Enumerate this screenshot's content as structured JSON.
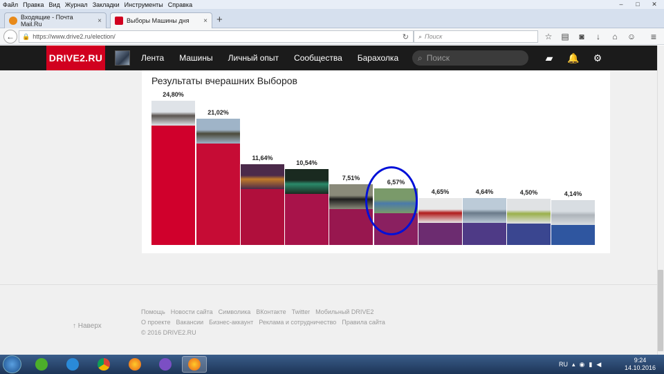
{
  "menu": [
    "Файл",
    "Правка",
    "Вид",
    "Журнал",
    "Закладки",
    "Инструменты",
    "Справка"
  ],
  "window_controls": [
    "–",
    "□",
    "✕"
  ],
  "tabs": [
    {
      "label": "Входящие - Почта Mail.Ru",
      "favicon_color": "#e88a1a"
    },
    {
      "label": "Выборы Машины дня",
      "favicon_color": "#d1001f"
    }
  ],
  "tab_close": "×",
  "new_tab": "+",
  "address": {
    "url": "https://www.drive2.ru/election/",
    "search_placeholder": "Поиск"
  },
  "site": {
    "logo": "DRIVE2.RU",
    "nav": [
      "Лента",
      "Машины",
      "Личный опыт",
      "Сообщества",
      "Барахолка"
    ],
    "search_placeholder": "Поиск"
  },
  "section_title": "Результаты вчерашних Выборов",
  "chart_data": {
    "type": "bar",
    "title": "Результаты вчерашних Выборов",
    "values": [
      24.8,
      21.02,
      11.64,
      10.54,
      7.51,
      6.57,
      4.65,
      4.64,
      4.5,
      4.14
    ],
    "labels": [
      "24,80%",
      "21,02%",
      "11,64%",
      "10,54%",
      "7,51%",
      "6,57%",
      "4,65%",
      "4,64%",
      "4,50%",
      "4,14%"
    ],
    "colors": [
      "#d0002c",
      "#c60c35",
      "#b00f3c",
      "#a8134a",
      "#98174f",
      "#8a2060",
      "#6c2c70",
      "#4e3a86",
      "#3a4690",
      "#2f56a0"
    ],
    "photo_colors": [
      [
        "#dfe3e8",
        "#5b5450"
      ],
      [
        "#9fb4c8",
        "#4b4a3a"
      ],
      [
        "#4b2a4a",
        "#c07a2a"
      ],
      [
        "#1a2a20",
        "#2a8a6a"
      ],
      [
        "#8a8a7a",
        "#1e1e1e"
      ],
      [
        "#7a9a6a",
        "#4a7aaa"
      ],
      [
        "#e8e8e8",
        "#b01a1a"
      ],
      [
        "#bccbd8",
        "#6a7a8a"
      ],
      [
        "#e0e2e4",
        "#9ab04a"
      ],
      [
        "#d8dde2",
        "#aeb4ba"
      ]
    ],
    "highlighted_index": 5
  },
  "footer": {
    "up_label": "↑ Наверх",
    "row1": [
      "Помощь",
      "Новости сайта",
      "Символика",
      "ВКонтакте",
      "Twitter",
      "Мобильный DRIVE2"
    ],
    "row2": [
      "О проекте",
      "Вакансии",
      "Бизнес-аккаунт",
      "Реклама и сотрудничество",
      "Правила сайта"
    ],
    "copyright": "© 2016 DRIVE2.RU"
  },
  "taskbar": {
    "lang": "RU",
    "time": "9:24",
    "date": "14.10.2016"
  }
}
